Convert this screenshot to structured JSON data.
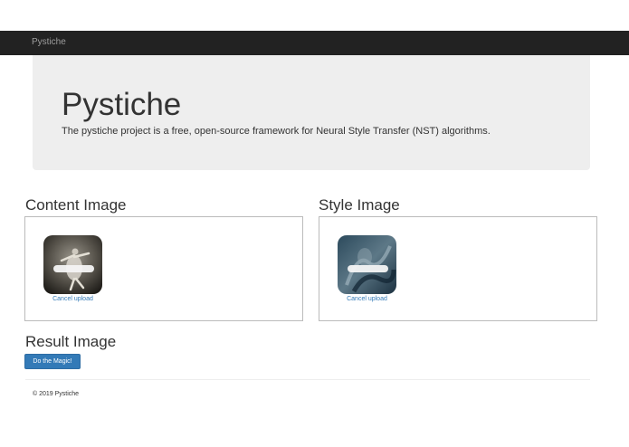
{
  "navbar": {
    "brand": "Pystiche"
  },
  "jumbotron": {
    "title": "Pystiche",
    "lead": "The pystiche project is a free, open-source framework for Neural Style Transfer (NST) algorithms."
  },
  "content_image": {
    "title": "Content Image",
    "cancel_label": "Cancel upload",
    "remove_icon": "minus-bar-icon"
  },
  "style_image": {
    "title": "Style Image",
    "cancel_label": "Cancel upload",
    "remove_icon": "minus-bar-icon"
  },
  "result": {
    "title": "Result Image",
    "button_label": "Do the Magic!"
  },
  "footer": {
    "text": "© 2019 Pystiche"
  },
  "colors": {
    "navbar": "#222222",
    "jumbotron": "#eeeeee",
    "link": "#337ab7",
    "button": "#337ab7"
  }
}
